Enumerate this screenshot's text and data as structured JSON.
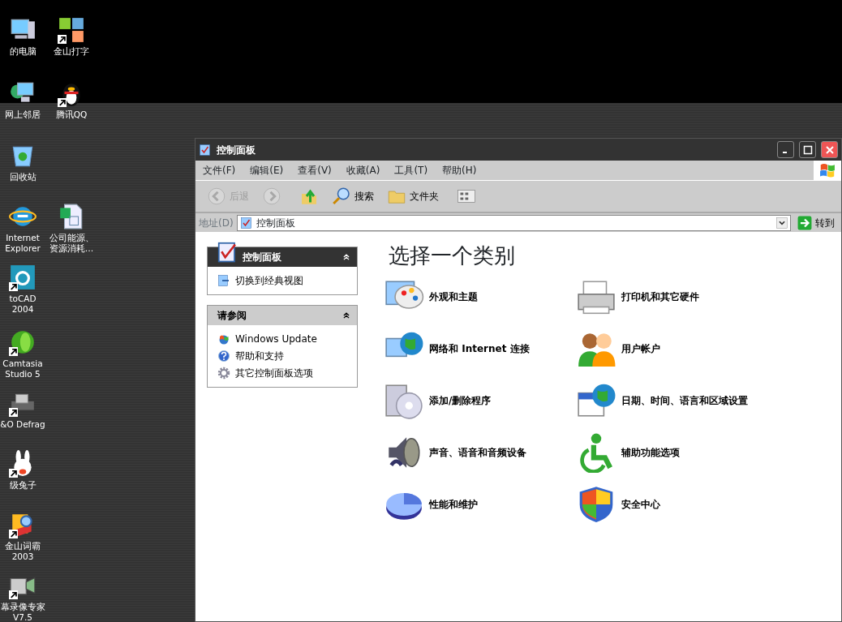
{
  "desktop_icons": [
    {
      "label": "的电脑",
      "shortcut": false,
      "kind": "computer"
    },
    {
      "label": "金山打字",
      "shortcut": true,
      "kind": "blocks"
    },
    {
      "label": "网上邻居",
      "shortcut": false,
      "kind": "network"
    },
    {
      "label": "腾讯QQ",
      "shortcut": true,
      "kind": "penguin"
    },
    {
      "label": "回收站",
      "shortcut": false,
      "kind": "bin"
    },
    {
      "label": "Internet Explorer",
      "shortcut": false,
      "kind": "browser"
    },
    {
      "label": "公司能源、资源消耗…",
      "shortcut": false,
      "kind": "sheet"
    },
    {
      "label": "toCAD 2004",
      "shortcut": true,
      "kind": "cad"
    },
    {
      "label": "Camtasia Studio 5",
      "shortcut": true,
      "kind": "ball"
    },
    {
      "label": "&O Defrag",
      "shortcut": true,
      "kind": "disk"
    },
    {
      "label": "级兔子",
      "shortcut": true,
      "kind": "rabbit"
    },
    {
      "label": "金山词霸 2003",
      "shortcut": true,
      "kind": "book"
    },
    {
      "label": "幕录像专家V7.5",
      "shortcut": true,
      "kind": "camera"
    }
  ],
  "window": {
    "title": "控制面板",
    "menu": [
      "文件(F)",
      "编辑(E)",
      "查看(V)",
      "收藏(A)",
      "工具(T)",
      "帮助(H)"
    ],
    "toolbar": [
      {
        "label": "后退",
        "kind": "back",
        "disabled": true
      },
      {
        "kind": "forward",
        "disabled": true
      },
      {
        "kind": "up",
        "disabled": false
      },
      {
        "label": "搜索",
        "kind": "search",
        "disabled": false
      },
      {
        "label": "文件夹",
        "kind": "folders",
        "disabled": false
      },
      {
        "kind": "views",
        "disabled": false
      }
    ],
    "address": {
      "label": "地址(D)",
      "value": "控制面板",
      "go": "转到"
    },
    "sidebar": [
      {
        "title": "控制面板",
        "kind": "primary",
        "items": [
          {
            "label": "切换到经典视图",
            "kind": "switch"
          }
        ]
      },
      {
        "title": "请参阅",
        "kind": "secondary",
        "items": [
          {
            "label": "Windows Update",
            "kind": "update"
          },
          {
            "label": "帮助和支持",
            "kind": "help"
          },
          {
            "label": "其它控制面板选项",
            "kind": "gear"
          }
        ]
      }
    ],
    "heading": "选择一个类别",
    "categories": [
      {
        "label": "外观和主题",
        "kind": "palette"
      },
      {
        "label": "打印机和其它硬件",
        "kind": "printer"
      },
      {
        "label": "网络和 Internet 连接",
        "kind": "globe"
      },
      {
        "label": "用户帐户",
        "kind": "users"
      },
      {
        "label": "添加/删除程序",
        "kind": "cd"
      },
      {
        "label": "日期、时间、语言和区域设置",
        "kind": "calendar"
      },
      {
        "label": "声音、语音和音频设备",
        "kind": "speaker"
      },
      {
        "label": "辅助功能选项",
        "kind": "access"
      },
      {
        "label": "性能和维护",
        "kind": "chart"
      },
      {
        "label": "安全中心",
        "kind": "shield"
      }
    ]
  }
}
